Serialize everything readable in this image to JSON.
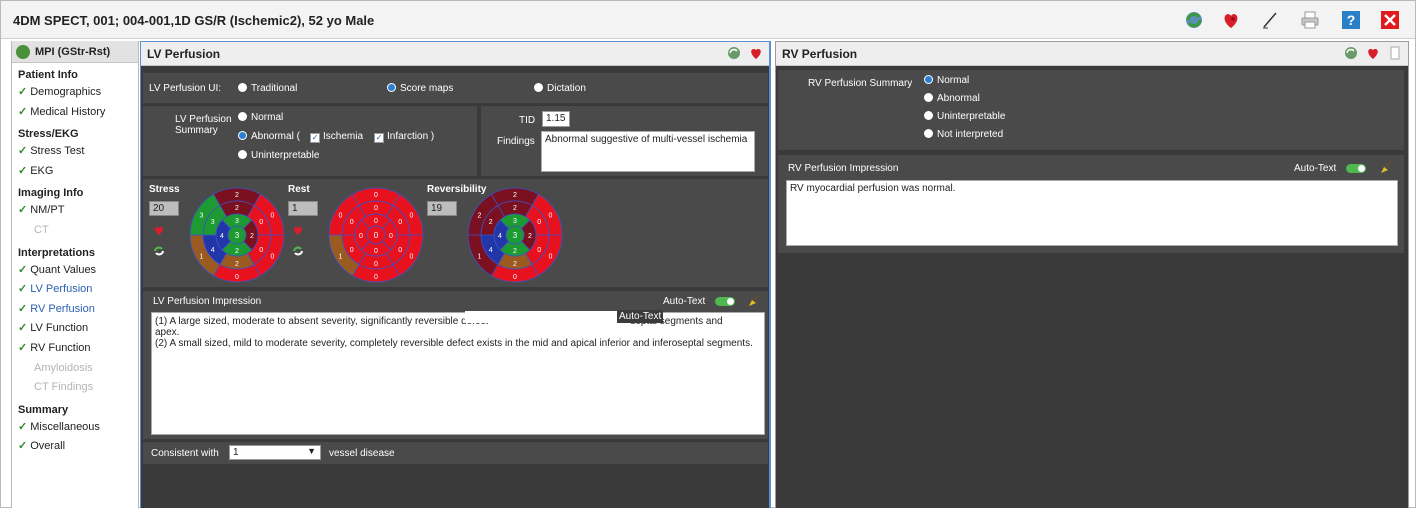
{
  "window": {
    "title": "4DM SPECT, 001; 004-001,1D GS/R (Ischemic2), 52 yo Male"
  },
  "toolbar_icons": [
    "globe-refresh-icon",
    "heart-icon",
    "pen-icon",
    "printer-icon",
    "help-icon",
    "close-icon"
  ],
  "sidebar": {
    "header": "MPI (GStr-Rst)",
    "sections": [
      {
        "title": "Patient Info",
        "items": [
          {
            "label": "Demographics",
            "checked": true
          },
          {
            "label": "Medical History",
            "checked": true
          }
        ]
      },
      {
        "title": "Stress/EKG",
        "items": [
          {
            "label": "Stress Test",
            "checked": true
          },
          {
            "label": "EKG",
            "checked": true
          }
        ]
      },
      {
        "title": "Imaging Info",
        "items": [
          {
            "label": "NM/PT",
            "checked": true
          },
          {
            "label": "CT",
            "checked": false
          }
        ]
      },
      {
        "title": "Interpretations",
        "items": [
          {
            "label": "Quant Values",
            "checked": true
          },
          {
            "label": "LV Perfusion",
            "checked": true
          },
          {
            "label": "RV Perfusion",
            "checked": true
          },
          {
            "label": "LV Function",
            "checked": true
          },
          {
            "label": "RV Function",
            "checked": true
          },
          {
            "label": "Amyloidosis",
            "checked": false
          },
          {
            "label": "CT Findings",
            "checked": false
          }
        ]
      },
      {
        "title": "Summary",
        "items": [
          {
            "label": "Miscellaneous",
            "checked": true
          },
          {
            "label": "Overall",
            "checked": true
          }
        ]
      }
    ]
  },
  "lv": {
    "title": "LV Perfusion",
    "ui_label": "LV Perfusion UI:",
    "ui_options": [
      "Traditional",
      "Score maps",
      "Dictation"
    ],
    "ui_selected": "Score maps",
    "summary_label": "LV Perfusion Summary",
    "summary_options": {
      "normal": "Normal",
      "abnormal": "Abnormal",
      "open_paren": "(",
      "ischemia": "Ischemia",
      "infarction": "Infarction",
      "close_paren": ")",
      "uninterpretable": "Uninterpretable"
    },
    "summary_selected": "Abnormal",
    "tid_label": "TID",
    "tid_value": "1.15",
    "findings_label": "Findings",
    "findings_value": "Abnormal suggestive of multi-vessel ischemia",
    "maps": [
      {
        "label": "Stress",
        "score": "20"
      },
      {
        "label": "Rest",
        "score": "1"
      },
      {
        "label": "Reversibility",
        "score": "19"
      }
    ],
    "impression_label": "LV Perfusion Impression",
    "autotext_label": "Auto-Text",
    "tooltip": "Auto-Text",
    "impression_lines": [
      "(1) A large sized, moderate to absent severity, significantly reversible defect",
      "septal segments and",
      "apex.",
      "(2) A small sized, mild to moderate severity, completely reversible defect exists in the mid and apical inferior and inferoseptal segments."
    ],
    "consistent_label": "Consistent with",
    "consistent_value": "1",
    "vessel_label": "vessel disease"
  },
  "rv": {
    "title": "RV Perfusion",
    "summary_label": "RV Perfusion Summary",
    "options": [
      "Normal",
      "Abnormal",
      "Uninterpretable",
      "Not interpreted"
    ],
    "selected": "Normal",
    "impression_label": "RV Perfusion Impression",
    "autotext_label": "Auto-Text",
    "impression_text": "RV myocardial perfusion was normal."
  },
  "colors": {
    "accent": "#2d7fd0",
    "ok": "#2e8b2e",
    "panel_bg": "#3a3a3a",
    "sub_bg": "#4a4a4a",
    "map_red": "#e8121f",
    "map_dark": "#7a1020",
    "map_green": "#1d9b32",
    "map_blue": "#2236a8",
    "map_brown": "#9a5a20"
  }
}
